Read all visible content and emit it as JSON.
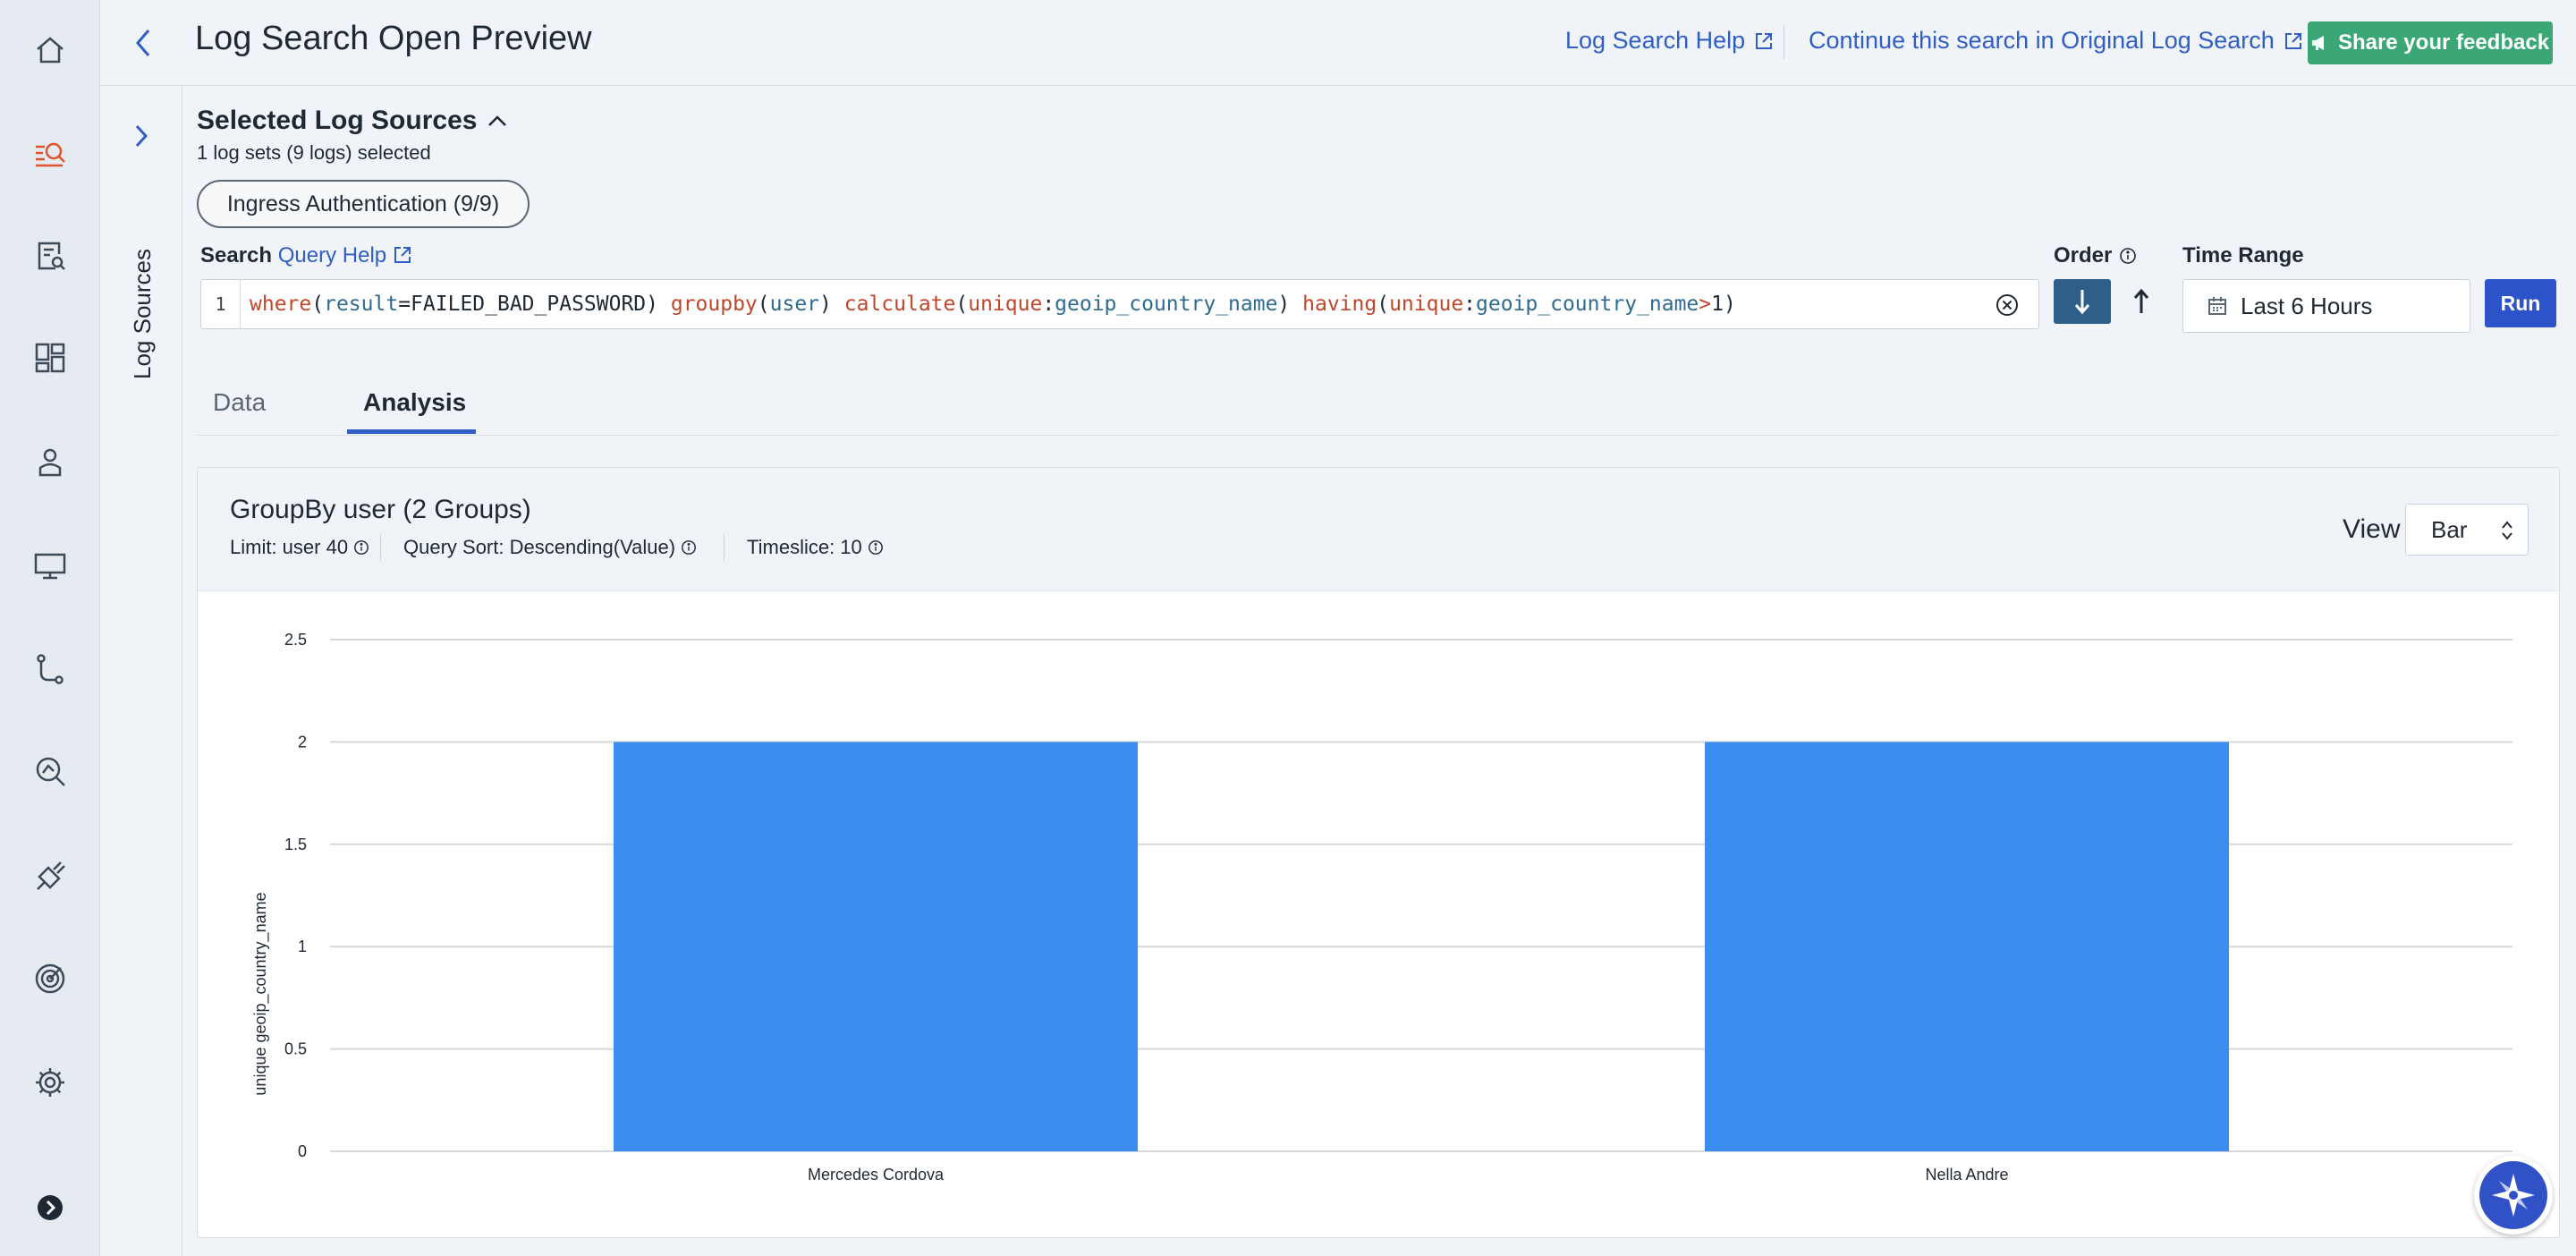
{
  "header": {
    "title": "Log Search Open Preview",
    "help_link": "Log Search Help",
    "continue_link": "Continue this search in Original Log Search",
    "feedback_button": "Share your feedback"
  },
  "side_tab": {
    "label": "Log Sources"
  },
  "sources": {
    "title": "Selected Log Sources",
    "summary": "1 log sets (9 logs) selected",
    "chip": "Ingress Authentication (9/9)"
  },
  "search": {
    "label": "Search",
    "help_link": "Query Help",
    "line_number": "1",
    "query": "where(result=FAILED_BAD_PASSWORD) groupby(user) calculate(unique:geoip_country_name) having(unique:geoip_country_name>1)",
    "tokens": [
      {
        "t": "where",
        "c": "kw"
      },
      {
        "t": "(",
        "c": ""
      },
      {
        "t": "result",
        "c": "fld"
      },
      {
        "t": "=FAILED_BAD_PASSWORD) ",
        "c": ""
      },
      {
        "t": "groupby",
        "c": "kw"
      },
      {
        "t": "(",
        "c": ""
      },
      {
        "t": "user",
        "c": "fld"
      },
      {
        "t": ") ",
        "c": ""
      },
      {
        "t": "calculate",
        "c": "kw"
      },
      {
        "t": "(",
        "c": ""
      },
      {
        "t": "unique",
        "c": "kw"
      },
      {
        "t": ":",
        "c": ""
      },
      {
        "t": "geoip_country_name",
        "c": "fld"
      },
      {
        "t": ") ",
        "c": ""
      },
      {
        "t": "having",
        "c": "kw"
      },
      {
        "t": "(",
        "c": ""
      },
      {
        "t": "unique",
        "c": "kw"
      },
      {
        "t": ":",
        "c": ""
      },
      {
        "t": "geoip_country_name",
        "c": "fld"
      },
      {
        "t": ">",
        "c": "kw"
      },
      {
        "t": "1)",
        "c": ""
      }
    ]
  },
  "order": {
    "label": "Order",
    "selected": "descending"
  },
  "time_range": {
    "label": "Time Range",
    "value": "Last 6 Hours"
  },
  "run_button": "Run",
  "tabs": [
    {
      "label": "Data",
      "active": false
    },
    {
      "label": "Analysis",
      "active": true
    }
  ],
  "analysis": {
    "title": "GroupBy user (2 Groups)",
    "limit": "Limit: user 40",
    "sort": "Query Sort: Descending(Value)",
    "timeslice": "Timeslice: 10",
    "view_label": "View",
    "view_value": "Bar"
  },
  "colors": {
    "accent": "#2f5ec4",
    "bar": "#3b8ef0",
    "feedback": "#3ba776",
    "run": "#2c53c9",
    "order_active": "#2e5f8a"
  },
  "chart_data": {
    "type": "bar",
    "categories": [
      "Mercedes Cordova",
      "Nella Andre"
    ],
    "values": [
      2,
      2
    ],
    "ylabel": "unique geoip_country_name",
    "xlabel": "",
    "ylim": [
      0,
      2.5
    ],
    "yticks": [
      "0",
      "0.5",
      "1",
      "1.5",
      "2",
      "2.5"
    ],
    "grid": true
  }
}
